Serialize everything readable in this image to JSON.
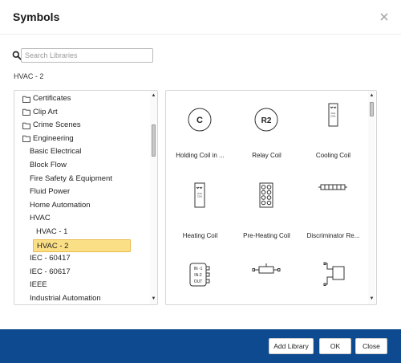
{
  "dialog": {
    "title": "Symbols"
  },
  "search": {
    "placeholder": "Search Libraries",
    "value": ""
  },
  "breadcrumb": "HVAC - 2",
  "tree": {
    "items": [
      {
        "label": "Certificates",
        "type": "folder",
        "level": 0
      },
      {
        "label": "Clip Art",
        "type": "folder",
        "level": 0
      },
      {
        "label": "Crime Scenes",
        "type": "folder",
        "level": 0
      },
      {
        "label": "Engineering",
        "type": "folder",
        "level": 0
      },
      {
        "label": "Basic Electrical",
        "type": "item",
        "level": 1
      },
      {
        "label": "Block Flow",
        "type": "item",
        "level": 1
      },
      {
        "label": "Fire Safety & Equipment",
        "type": "item",
        "level": 1
      },
      {
        "label": "Fluid Power",
        "type": "item",
        "level": 1
      },
      {
        "label": "Home Automation",
        "type": "item",
        "level": 1
      },
      {
        "label": "HVAC",
        "type": "item",
        "level": 1
      },
      {
        "label": "HVAC - 1",
        "type": "item",
        "level": 2
      },
      {
        "label": "HVAC - 2",
        "type": "item",
        "level": 2,
        "selected": true
      },
      {
        "label": "IEC - 60417",
        "type": "item",
        "level": 1
      },
      {
        "label": "IEC - 60617",
        "type": "item",
        "level": 1
      },
      {
        "label": "IEEE",
        "type": "item",
        "level": 1
      },
      {
        "label": "Industrial Automation",
        "type": "item",
        "level": 1
      }
    ]
  },
  "symbols": [
    {
      "label": "Holding Coil in ...",
      "icon_name": "holding-coil-icon",
      "icon_text": "C"
    },
    {
      "label": "Relay Coil",
      "icon_name": "relay-coil-icon",
      "icon_text": "R2"
    },
    {
      "label": "Cooling Coil",
      "icon_name": "cooling-coil-icon",
      "icon_text": "CLG COIL"
    },
    {
      "label": "Heating Coil",
      "icon_name": "heating-coil-icon",
      "icon_text": "HTG COIL"
    },
    {
      "label": "Pre-Heating Coil",
      "icon_name": "pre-heating-coil-icon",
      "icon_text": ""
    },
    {
      "label": "Discriminator Re...",
      "icon_name": "discriminator-relay-icon",
      "icon_text": ""
    },
    {
      "label": "",
      "icon_name": "input-output-block-icon",
      "icon_text": [
        "IN -1",
        "IN-2",
        "OUT"
      ]
    },
    {
      "label": "",
      "icon_name": "inline-connector-icon",
      "icon_text": ""
    },
    {
      "label": "",
      "icon_name": "junction-box-icon",
      "icon_text": ""
    }
  ],
  "buttons": {
    "add_library": "Add Library",
    "ok": "OK",
    "close": "Close"
  },
  "colors": {
    "footer": "#0e4a8f",
    "selection_fill": "#fbdf86",
    "selection_border": "#e9b94b"
  }
}
